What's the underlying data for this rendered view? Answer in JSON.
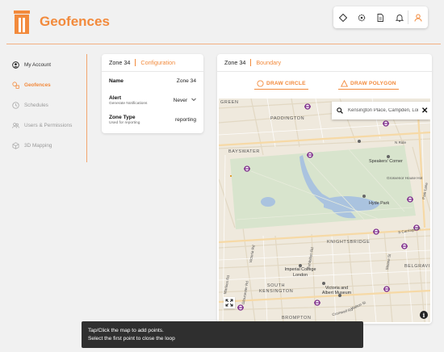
{
  "app": {
    "title": "Geofences",
    "accent": "#f28a3c"
  },
  "toolbar": {
    "icons": [
      "diamond-icon",
      "gear-icon",
      "document-icon",
      "bell-icon",
      "user-icon"
    ]
  },
  "sidebar": {
    "items": [
      {
        "label": "My Account",
        "icon": "account-circle-icon",
        "state": "default"
      },
      {
        "label": "Geofences",
        "icon": "geofence-icon",
        "state": "active"
      },
      {
        "label": "Schedules",
        "icon": "clock-icon",
        "state": "disabled"
      },
      {
        "label": "Users & Permissions",
        "icon": "users-icon",
        "state": "disabled"
      },
      {
        "label": "3D Mapping",
        "icon": "cube-icon",
        "state": "disabled"
      }
    ]
  },
  "config": {
    "zone": "Zone 34",
    "tab": "Configuration",
    "name_label": "Name",
    "name_value": "Zone 34",
    "alert_label": "Alert",
    "alert_sub": "Generate Notifications",
    "alert_value": "Never",
    "zone_type_label": "Zone Type",
    "zone_type_sub": "Used for reporting",
    "zone_type_value": "reporting"
  },
  "map_panel": {
    "zone": "Zone 34",
    "tab": "Boundary",
    "draw_circle": "DRAW CIRCLE",
    "draw_polygon": "DRAW POLYGON",
    "search_value": "Kensington Place, Campden, London",
    "close_symbol": "✕",
    "info_symbol": "i",
    "labels": {
      "green": "GREEN",
      "paddington": "PADDINGTON",
      "bayswater": "BAYSWATER",
      "speakers_corner": "Speakers' Corner",
      "grosvenor": "Grosvenor House Hot",
      "park_lane": "Park Lane",
      "hyde_park": "Hyde Park",
      "knightsbridge": "KNIGHTSBRIDGE",
      "belgravia": "BELGRAVI",
      "imperial": "Imperial College London",
      "south_kensington": "SOUTH KENSINGTON",
      "va": "Victoria and Albert Museum",
      "brompton": "BROMPTON",
      "carriage_dr": "S Carriage Dr",
      "n_ride": "N Ride",
      "victoria_rd": "Victoria Rd",
      "gloucester_rd": "Gloucester Rd",
      "exhibition_rd": "Exhibition Rd",
      "sloane_st": "Sloane St",
      "walton_st": "Walton St",
      "marloes_rd": "Marloes Rd",
      "cromwell_rd": "Cromwell Rd"
    }
  },
  "toast": {
    "line1": "Tap/Click the map to add points.",
    "line2": "Select the first point to close the loop"
  }
}
